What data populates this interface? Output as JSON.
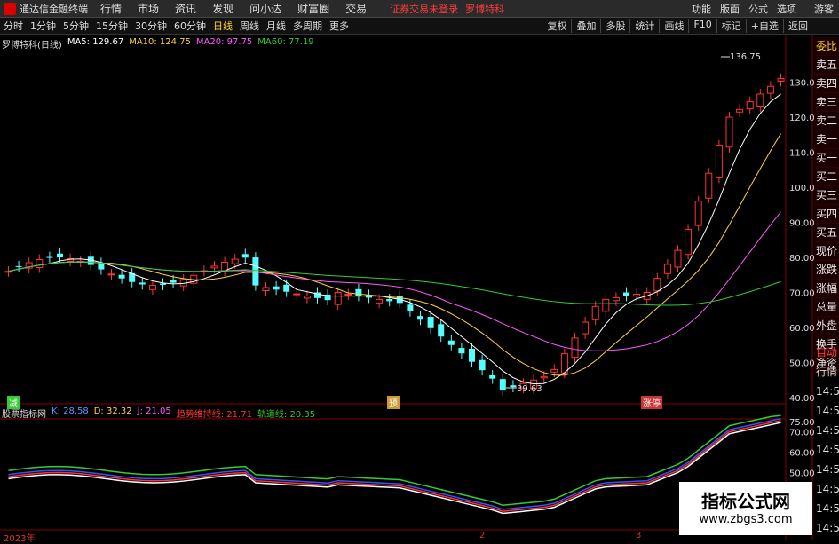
{
  "menubar": {
    "app_title": "通达信金融终端",
    "items": [
      "行情",
      "市场",
      "资讯",
      "发现",
      "问小达",
      "财富圈",
      "交易"
    ],
    "status": "证券交易未登录",
    "stock_name": "罗博特科",
    "right": [
      "功能",
      "版面",
      "公式",
      "选项",
      "",
      "游客"
    ]
  },
  "toolbar": {
    "periods": [
      "分时",
      "1分钟",
      "5分钟",
      "15分钟",
      "30分钟",
      "60分钟",
      "日线",
      "周线",
      "月线",
      "多周期",
      "更多"
    ],
    "active_period": "日线",
    "right": [
      "复权",
      "叠加",
      "多股",
      "统计",
      "画线",
      "F10",
      "标记",
      "+自选",
      "返回"
    ]
  },
  "legend": {
    "name": "罗博特科(日线)",
    "ma5": "MA5: 129.67",
    "ma10": "MA10: 124.75",
    "ma20": "MA20: 97.75",
    "ma60": "MA60: 77.19"
  },
  "price_axis": [
    "130.00",
    "120.00",
    "110.00",
    "100.00",
    "90.00",
    "80.00",
    "70.00",
    "60.00",
    "50.00",
    "40.00"
  ],
  "annotations": {
    "high": "136.75",
    "low": "39.63"
  },
  "markers": {
    "m1": "减",
    "m2": "预",
    "m3": "涨停"
  },
  "side_panel": [
    "委比",
    "卖五",
    "卖四",
    "卖三",
    "卖二",
    "卖一",
    "买一",
    "买二",
    "买三",
    "买四",
    "买五",
    "现价",
    "涨跌",
    "涨幅",
    "总量",
    "外盘",
    "换手",
    "净资",
    "收益"
  ],
  "side_tabs": [
    "自动",
    "行情"
  ],
  "side_times": [
    "14:50",
    "14:50",
    "14:50",
    "14:50",
    "14:50",
    "14:50",
    "14:50",
    "14:50"
  ],
  "indicator": {
    "name": "股票指标网",
    "k": "K: 28.58",
    "d_label": "D: 32.32",
    "j": "J: 21.05",
    "trend": "趋势维持线: 21.71",
    "track": "轨道线: 20.35",
    "axis": [
      "75.00",
      "70.00",
      "60.00",
      "50.00"
    ]
  },
  "x_labels": {
    "year": "2023年",
    "m2": "2",
    "m3": "3"
  },
  "watermark": {
    "line1": "指标公式网",
    "line2": "www.zbgs3.com"
  },
  "colors": {
    "up": "#ff3333",
    "down": "#54ffff",
    "ma5": "#ffffff",
    "ma10": "#ffd23a",
    "ma20": "#ff59ff",
    "ma60": "#33cc33"
  }
}
